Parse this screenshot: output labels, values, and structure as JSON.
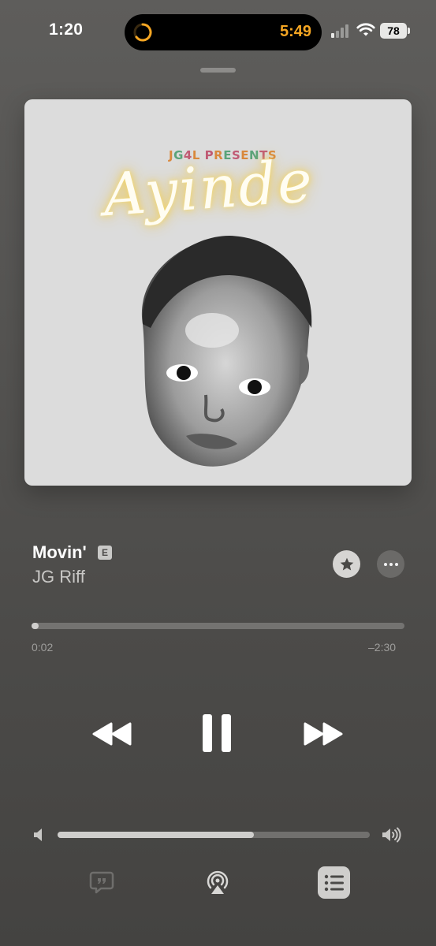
{
  "status_bar": {
    "time": "1:20",
    "island_timer_time": "5:49",
    "battery": "78"
  },
  "artwork": {
    "presents_text": "JG4L PRESENTS",
    "album_title": "Ayinde"
  },
  "track": {
    "title": "Movin'",
    "explicit_badge": "E",
    "artist": "JG Riff"
  },
  "progress": {
    "elapsed": "0:02",
    "remaining": "–2:30",
    "fraction": 0.013
  },
  "volume": {
    "level": 0.63
  },
  "colors": {
    "island_timer": "#f5a623",
    "background": "#555452",
    "accent_text": "#ffffff"
  },
  "icons": {
    "star": "star-icon",
    "more": "ellipsis-icon",
    "rewind": "backward-icon",
    "pause": "pause-icon",
    "forward": "forward-icon",
    "lyrics": "quote-bubble-icon",
    "airplay": "airplay-icon",
    "queue": "list-icon"
  }
}
